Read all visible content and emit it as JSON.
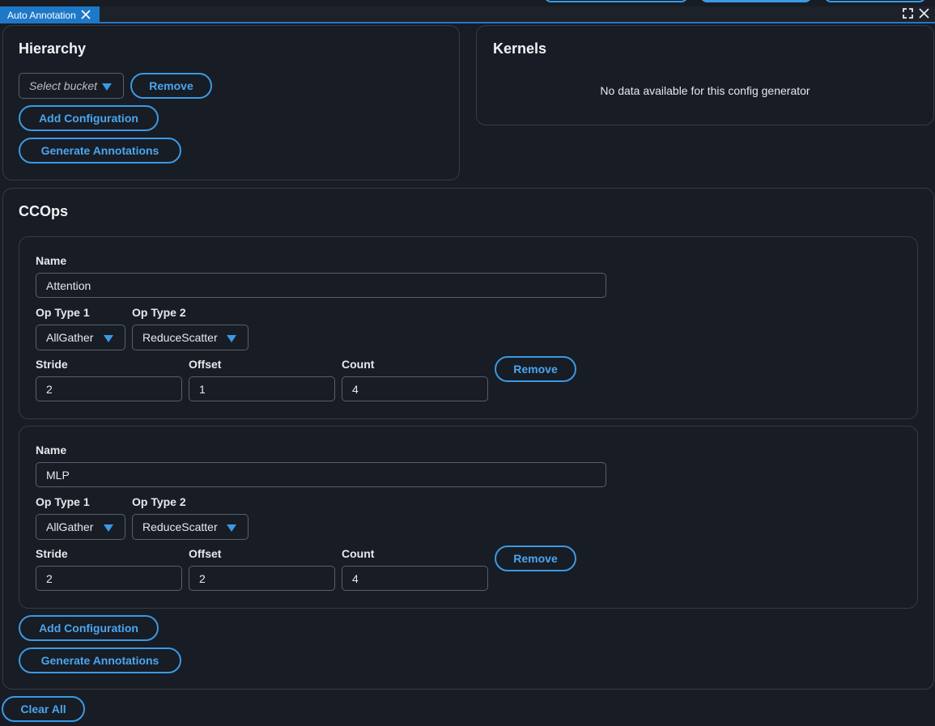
{
  "tab": {
    "title": "Auto Annotation"
  },
  "hierarchy": {
    "title": "Hierarchy",
    "bucket_placeholder": "Select bucket",
    "remove_label": "Remove",
    "add_config_label": "Add Configuration",
    "generate_label": "Generate Annotations"
  },
  "kernels": {
    "title": "Kernels",
    "empty_text": "No data available for this config generator"
  },
  "ccops": {
    "title": "CCOps",
    "labels": {
      "name": "Name",
      "op_type_1": "Op Type 1",
      "op_type_2": "Op Type 2",
      "stride": "Stride",
      "offset": "Offset",
      "count": "Count",
      "remove": "Remove"
    },
    "configs": [
      {
        "name": "Attention",
        "op_type_1": "AllGather",
        "op_type_2": "ReduceScatter",
        "stride": "2",
        "offset": "1",
        "count": "4"
      },
      {
        "name": "MLP",
        "op_type_1": "AllGather",
        "op_type_2": "ReduceScatter",
        "stride": "2",
        "offset": "2",
        "count": "4"
      }
    ],
    "add_config_label": "Add Configuration",
    "generate_label": "Generate Annotations"
  },
  "clear_all_label": "Clear All",
  "colors": {
    "accent": "#3a9ae4",
    "tab_active": "#1e78c8",
    "background": "#181c24",
    "border": "#353a45"
  }
}
